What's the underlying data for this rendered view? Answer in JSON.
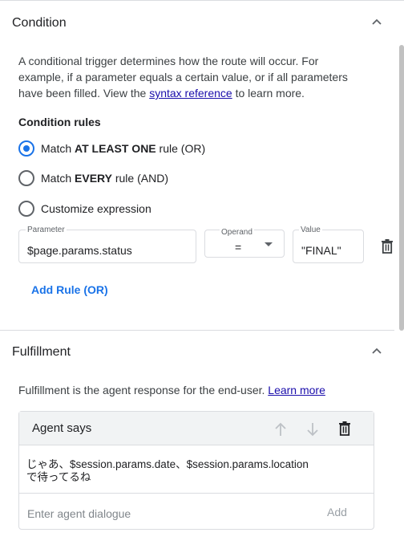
{
  "condition": {
    "title": "Condition",
    "description_part1": "A conditional trigger determines how the route will occur. For example, if a parameter equals a certain value, or if all parameters have been filled. View the ",
    "description_link": "syntax reference",
    "description_part2": " to learn more.",
    "rules_title": "Condition rules",
    "options": [
      {
        "prefix": "Match ",
        "bold": "AT LEAST ONE",
        "suffix": " rule (OR)",
        "checked": true
      },
      {
        "prefix": "Match ",
        "bold": "EVERY",
        "suffix": " rule (AND)",
        "checked": false
      },
      {
        "prefix": "Customize expression",
        "bold": "",
        "suffix": "",
        "checked": false
      }
    ],
    "rule": {
      "parameter_label": "Parameter",
      "parameter_value": "$page.params.status",
      "operand_label": "Operand",
      "operand_value": "=",
      "value_label": "Value",
      "value_value": "\"FINAL\""
    },
    "add_rule_label": "Add Rule (OR)"
  },
  "fulfillment": {
    "title": "Fulfillment",
    "description": "Fulfillment is the agent response for the end-user. ",
    "learn_more": "Learn more",
    "agent_says_title": "Agent says",
    "message_line1": "じゃあ、$session.params.date、$session.params.location",
    "message_line2": "で待ってるね",
    "input_placeholder": "Enter agent dialogue",
    "add_label": "Add"
  },
  "colors": {
    "accent": "#1a73e8",
    "link": "#1a0dab",
    "divider": "#dadce0"
  }
}
